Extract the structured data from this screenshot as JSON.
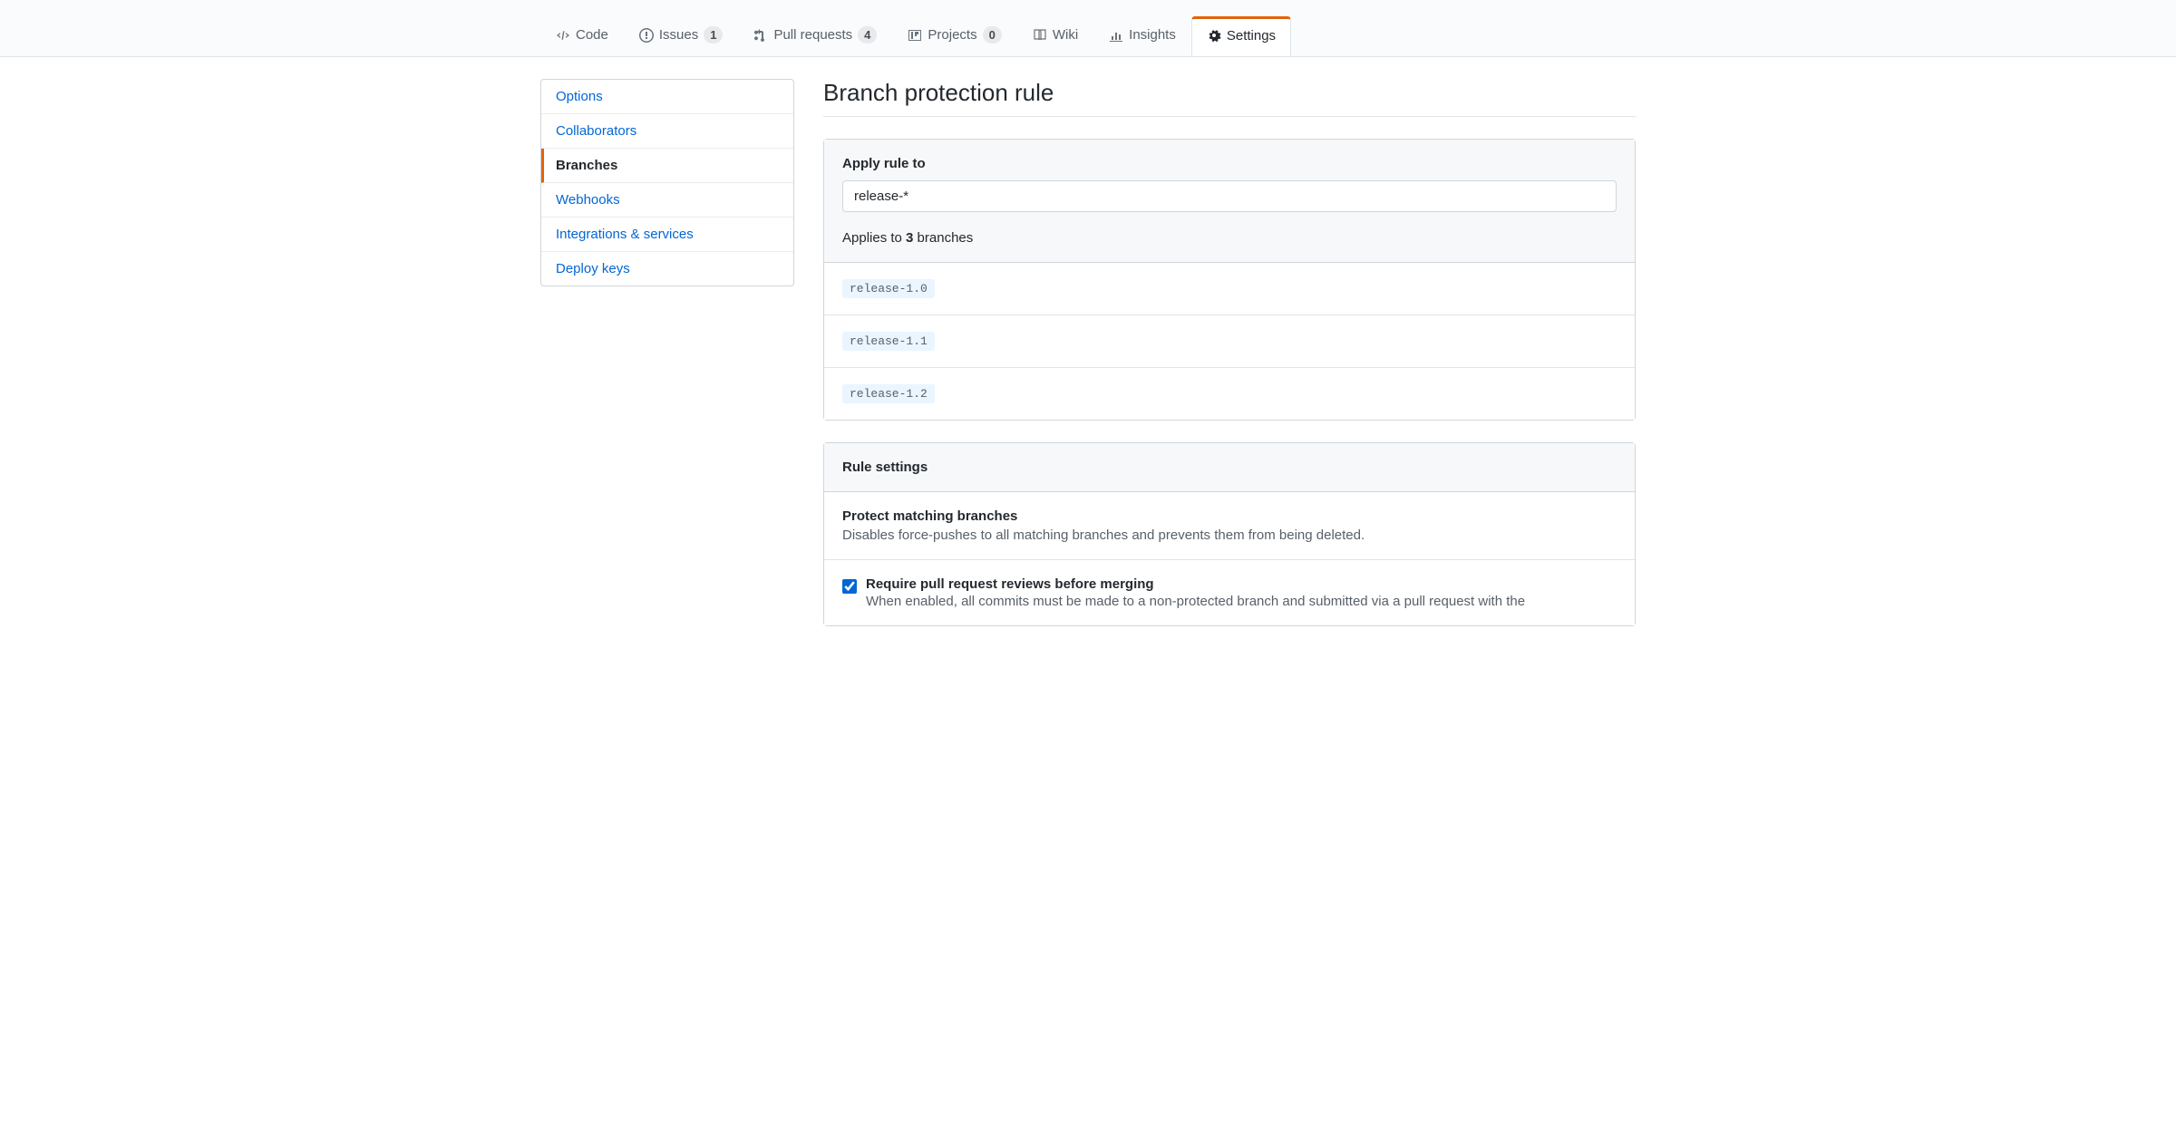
{
  "tabs": [
    {
      "label": "Code",
      "count": null
    },
    {
      "label": "Issues",
      "count": "1"
    },
    {
      "label": "Pull requests",
      "count": "4"
    },
    {
      "label": "Projects",
      "count": "0"
    },
    {
      "label": "Wiki",
      "count": null
    },
    {
      "label": "Insights",
      "count": null
    },
    {
      "label": "Settings",
      "count": null
    }
  ],
  "sidebar": {
    "items": [
      "Options",
      "Collaborators",
      "Branches",
      "Webhooks",
      "Integrations & services",
      "Deploy keys"
    ]
  },
  "page": {
    "title": "Branch protection rule"
  },
  "apply": {
    "label": "Apply rule to",
    "value": "release-*",
    "applies_prefix": "Applies to ",
    "applies_count": "3",
    "applies_suffix": " branches",
    "branches": [
      "release-1.0",
      "release-1.1",
      "release-1.2"
    ]
  },
  "settings": {
    "header": "Rule settings",
    "protect_title": "Protect matching branches",
    "protect_desc": "Disables force-pushes to all matching branches and prevents them from being deleted.",
    "require_title": "Require pull request reviews before merging",
    "require_desc": "When enabled, all commits must be made to a non-protected branch and submitted via a pull request with the"
  }
}
